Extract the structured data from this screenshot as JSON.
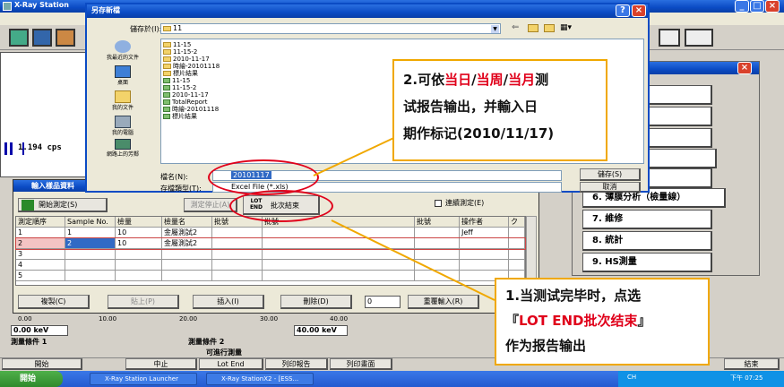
{
  "app": {
    "title": "X-Ray Station",
    "title_right_controls": [
      "_",
      "□",
      "×"
    ]
  },
  "main_status": {
    "cps": "1.194 cps",
    "kev_left": "0.00 keV",
    "kev_right": "40.00 keV",
    "axis_ticks": [
      "0.00",
      "10.00",
      "20.00",
      "30.00",
      "40.00"
    ],
    "cond1": "測量條件 1",
    "cond2": "測量條件 2",
    "ready": "可進行測量"
  },
  "right_panel": {
    "items": [
      "",
      "",
      "",
      "(ＦＰ)",
      "(檢量線)",
      "(ＦＰ)",
      "6. 薄膜分析（檢量線）",
      "7. 維修",
      "8. 統計",
      "9. HS測量"
    ]
  },
  "dialog": {
    "title": "另存新檔",
    "save_in_label": "儲存於(I):",
    "save_in_value": "11",
    "places": [
      "我最近的文件",
      "桌面",
      "我的文件",
      "我的電腦",
      "網路上的芳鄰"
    ],
    "files": [
      {
        "name": "11-15",
        "type": "folder"
      },
      {
        "name": "11-15-2",
        "type": "folder"
      },
      {
        "name": "2010-11-17",
        "type": "folder"
      },
      {
        "name": "時繪-20101118",
        "type": "folder"
      },
      {
        "name": "標片結果",
        "type": "folder"
      },
      {
        "name": "11-15",
        "type": "doc"
      },
      {
        "name": "11-15-2",
        "type": "doc"
      },
      {
        "name": "2010-11-17",
        "type": "doc"
      },
      {
        "name": "TotalReport",
        "type": "doc"
      },
      {
        "name": "時繪-20101118",
        "type": "doc"
      },
      {
        "name": "標片結果",
        "type": "doc"
      }
    ],
    "filename_label": "檔名(N):",
    "filename_value": "20101117",
    "filetype_label": "存檔類型(T):",
    "filetype_value": "Excel File (*.xls)",
    "save_button": "儲存(S)",
    "cancel_button": "取消"
  },
  "sample_window": {
    "title": "輸入樣品資料",
    "start_button": "開始測定(S)",
    "stop_button": "測定停止(A)",
    "lot_end_button_top": "LOT",
    "lot_end_button_bottom": "END",
    "lot_end_label": "批次結束",
    "continuous_label": "連續測定(E)",
    "columns": [
      "測定順序",
      "Sample No.",
      "檢量",
      "檢量名",
      "批號",
      "批號",
      "批號",
      "操作者",
      "ク"
    ],
    "rows": [
      [
        "1",
        "1",
        "10",
        "金屬測試2",
        "",
        "",
        "",
        "Jeff",
        ""
      ],
      [
        "2",
        "2",
        "10",
        "金屬測試2",
        "",
        "",
        "",
        "",
        ""
      ],
      [
        "3",
        "",
        "",
        "",
        "",
        "",
        "",
        "",
        ""
      ],
      [
        "4",
        "",
        "",
        "",
        "",
        "",
        "",
        "",
        ""
      ],
      [
        "5",
        "",
        "",
        "",
        "",
        "",
        "",
        "",
        ""
      ]
    ],
    "bottom_buttons": [
      "複製(C)",
      "貼上(P)",
      "插入(I)",
      "刪除(D)"
    ],
    "repeat_value": "0",
    "repeat_button": "重覆輸入(R)"
  },
  "toolbar_bottom": [
    "開始",
    "中止",
    "Lot End",
    "列印報告",
    "列印畫面"
  ],
  "bottom_right": [
    "",
    "",
    "",
    "結束"
  ],
  "taskbar": {
    "start": "開始",
    "items": [
      "X-Ray Station Launcher",
      "X-Ray StationX2 - [ESS..."
    ],
    "clock": "下午 07:25",
    "tray": "CH"
  },
  "callout_top": {
    "line1_a": "2.可依",
    "line1_b": "当日",
    "line1_c": "/",
    "line1_d": "当周",
    "line1_e": "/",
    "line1_f": "当月",
    "line1_g": "测",
    "line2": "试报告输出，并輸入日",
    "line3": "期作标记(2010/11/17)"
  },
  "callout_bottom": {
    "line1": "1.当测试完毕时，点选",
    "line2_a": "『",
    "line2_b": "LOT END批次结束",
    "line2_c": "』",
    "line3": "作为报告输出"
  },
  "colors": {
    "xp_blue": "#0b4bc4",
    "callout_border": "#f0a800",
    "highlight_red": "#e0001a"
  }
}
